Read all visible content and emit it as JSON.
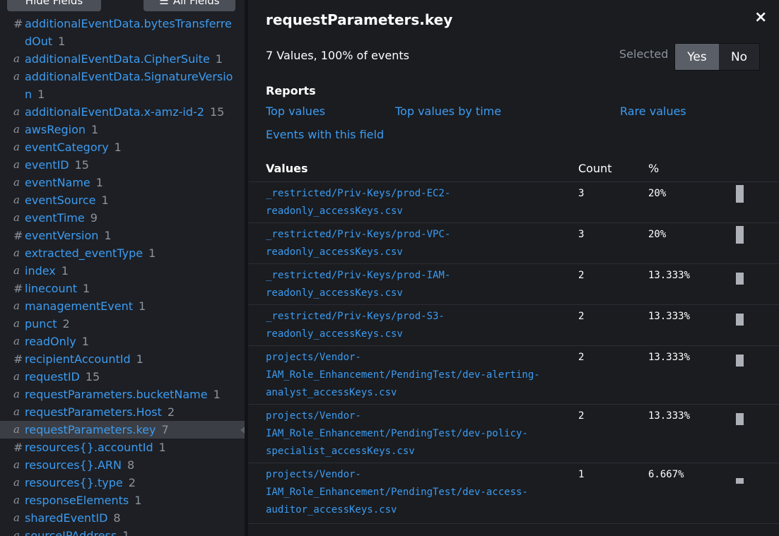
{
  "sidebar": {
    "hide_fields_label": "Hide Fields",
    "all_fields_label": "All Fields",
    "fields": [
      {
        "type": "#",
        "lines": [
          "additionalEventData.bytesTransferre",
          "dOut"
        ],
        "count": "1"
      },
      {
        "type": "a",
        "lines": [
          "additionalEventData.CipherSuite"
        ],
        "count": "1"
      },
      {
        "type": "a",
        "lines": [
          "additionalEventData.SignatureVersio",
          "n"
        ],
        "count": "1"
      },
      {
        "type": "a",
        "lines": [
          "additionalEventData.x-amz-id-2"
        ],
        "count": "15"
      },
      {
        "type": "a",
        "lines": [
          "awsRegion"
        ],
        "count": "1"
      },
      {
        "type": "a",
        "lines": [
          "eventCategory"
        ],
        "count": "1"
      },
      {
        "type": "a",
        "lines": [
          "eventID"
        ],
        "count": "15"
      },
      {
        "type": "a",
        "lines": [
          "eventName"
        ],
        "count": "1"
      },
      {
        "type": "a",
        "lines": [
          "eventSource"
        ],
        "count": "1"
      },
      {
        "type": "a",
        "lines": [
          "eventTime"
        ],
        "count": "9"
      },
      {
        "type": "#",
        "lines": [
          "eventVersion"
        ],
        "count": "1"
      },
      {
        "type": "a",
        "lines": [
          "extracted_eventType"
        ],
        "count": "1"
      },
      {
        "type": "a",
        "lines": [
          "index"
        ],
        "count": "1"
      },
      {
        "type": "#",
        "lines": [
          "linecount"
        ],
        "count": "1"
      },
      {
        "type": "a",
        "lines": [
          "managementEvent"
        ],
        "count": "1"
      },
      {
        "type": "a",
        "lines": [
          "punct"
        ],
        "count": "2"
      },
      {
        "type": "a",
        "lines": [
          "readOnly"
        ],
        "count": "1"
      },
      {
        "type": "#",
        "lines": [
          "recipientAccountId"
        ],
        "count": "1"
      },
      {
        "type": "a",
        "lines": [
          "requestID"
        ],
        "count": "15"
      },
      {
        "type": "a",
        "lines": [
          "requestParameters.bucketName"
        ],
        "count": "1"
      },
      {
        "type": "a",
        "lines": [
          "requestParameters.Host"
        ],
        "count": "2"
      },
      {
        "type": "a",
        "lines": [
          "requestParameters.key"
        ],
        "count": "7",
        "selected": true
      },
      {
        "type": "#",
        "lines": [
          "resources{}.accountId"
        ],
        "count": "1"
      },
      {
        "type": "a",
        "lines": [
          "resources{}.ARN"
        ],
        "count": "8"
      },
      {
        "type": "a",
        "lines": [
          "resources{}.type"
        ],
        "count": "2"
      },
      {
        "type": "a",
        "lines": [
          "responseElements"
        ],
        "count": "1"
      },
      {
        "type": "a",
        "lines": [
          "sharedEventID"
        ],
        "count": "8"
      },
      {
        "type": "a",
        "lines": [
          "sourceIPAddress"
        ],
        "count": "1"
      }
    ]
  },
  "panel": {
    "title": "requestParameters.key",
    "close_icon": "×",
    "summary": "7 Values, 100% of events",
    "selected_label": "Selected",
    "yes_label": "Yes",
    "no_label": "No",
    "reports_heading": "Reports",
    "reports": {
      "top_values": "Top values",
      "top_values_by_time": "Top values by time",
      "rare_values": "Rare values",
      "events_with_field": "Events with this field"
    },
    "table_headers": {
      "values": "Values",
      "count": "Count",
      "percent": "%"
    },
    "values": [
      {
        "lines": [
          "_restricted/Priv-Keys/prod-EC2-",
          "readonly_accessKeys.csv"
        ],
        "count": "3",
        "percent": "20%",
        "fraction": 0.2
      },
      {
        "lines": [
          "_restricted/Priv-Keys/prod-VPC-",
          "readonly_accessKeys.csv"
        ],
        "count": "3",
        "percent": "20%",
        "fraction": 0.2
      },
      {
        "lines": [
          "_restricted/Priv-Keys/prod-IAM-",
          "readonly_accessKeys.csv"
        ],
        "count": "2",
        "percent": "13.333%",
        "fraction": 0.13333
      },
      {
        "lines": [
          "_restricted/Priv-Keys/prod-S3-",
          "readonly_accessKeys.csv"
        ],
        "count": "2",
        "percent": "13.333%",
        "fraction": 0.13333
      },
      {
        "lines": [
          "projects/Vendor-",
          "IAM_Role_Enhancement/PendingTest/dev-alerting-",
          "analyst_accessKeys.csv"
        ],
        "count": "2",
        "percent": "13.333%",
        "fraction": 0.13333
      },
      {
        "lines": [
          "projects/Vendor-",
          "IAM_Role_Enhancement/PendingTest/dev-policy-",
          "specialist_accessKeys.csv"
        ],
        "count": "2",
        "percent": "13.333%",
        "fraction": 0.13333
      },
      {
        "lines": [
          "projects/Vendor-",
          "IAM_Role_Enhancement/PendingTest/dev-access-",
          "auditor_accessKeys.csv"
        ],
        "count": "1",
        "percent": "6.667%",
        "fraction": 0.06667
      }
    ]
  }
}
